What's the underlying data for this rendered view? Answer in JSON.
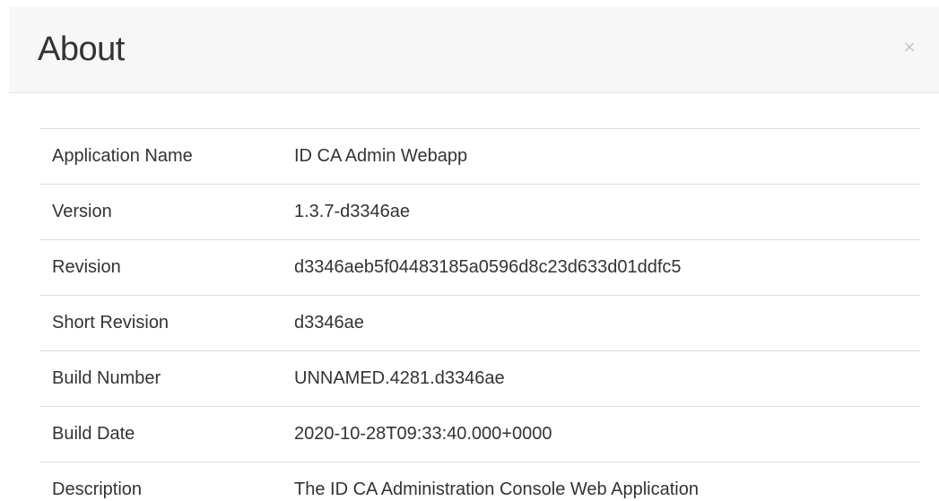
{
  "dialog": {
    "title": "About",
    "close_label": "×"
  },
  "info": {
    "rows": [
      {
        "label": "Application Name",
        "value": "ID CA Admin Webapp"
      },
      {
        "label": "Version",
        "value": "1.3.7-d3346ae"
      },
      {
        "label": "Revision",
        "value": "d3346aeb5f04483185a0596d8c23d633d01ddfc5"
      },
      {
        "label": "Short Revision",
        "value": "d3346ae"
      },
      {
        "label": "Build Number",
        "value": "UNNAMED.4281.d3346ae"
      },
      {
        "label": "Build Date",
        "value": "2020-10-28T09:33:40.000+0000"
      },
      {
        "label": "Description",
        "value": "The ID CA Administration Console Web Application"
      }
    ]
  },
  "colors": {
    "header_background": "#f7f7f7",
    "border": "#dddddd",
    "text": "#333333",
    "close_icon": "#c4c4c4"
  }
}
